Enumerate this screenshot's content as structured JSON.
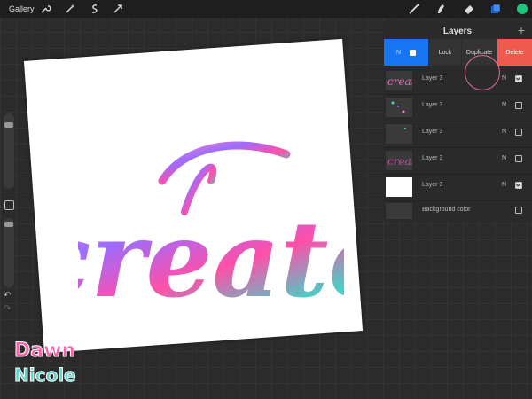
{
  "topbar": {
    "gallery_label": "Gallery",
    "left_tools": [
      "wrench-icon",
      "magic-wand-icon",
      "selection-icon",
      "transform-icon"
    ],
    "right_tools": [
      "brush-icon",
      "smudge-icon",
      "eraser-icon",
      "layers-icon",
      "color-icon"
    ],
    "color_swatch": "#21c57d"
  },
  "canvas": {
    "artwork_text": "create"
  },
  "layers_panel": {
    "title": "Layers",
    "actions": {
      "layer_mode": "N",
      "lock_label": "Lock",
      "duplicate_label": "Duplicate",
      "delete_label": "Delete"
    },
    "layers": [
      {
        "name": "Layer 3",
        "mode": "N",
        "visible": true
      },
      {
        "name": "Layer 3",
        "mode": "N",
        "visible": false
      },
      {
        "name": "Layer 3",
        "mode": "N",
        "visible": false
      },
      {
        "name": "Layer 3",
        "mode": "N",
        "visible": false
      },
      {
        "name": "Layer 3",
        "mode": "N",
        "visible": true
      }
    ],
    "background": {
      "name": "Background color",
      "visible": false
    }
  },
  "colors": {
    "accent": "#1675f0",
    "delete": "#f05a4e",
    "highlight": "#e46aa3"
  }
}
